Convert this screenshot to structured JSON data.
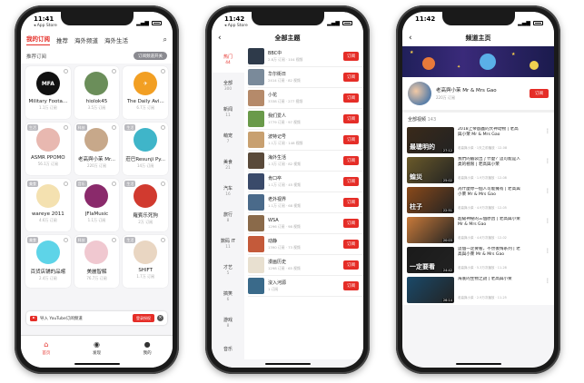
{
  "status": {
    "time1": "11:41",
    "time2": "11:42",
    "back_app": "◂ App Store"
  },
  "phone1": {
    "tabs": [
      "我的订阅",
      "推荐",
      "海外频道",
      "海外生活"
    ],
    "subhead_label": "推荐订阅",
    "subhead_button": "订阅频道开关",
    "cards": [
      {
        "name": "Military Foota...",
        "sub": "1.1万 订阅",
        "tag": "",
        "avatar_bg": "#111111",
        "avatar_text": "MFA"
      },
      {
        "name": "hiolok45",
        "sub": "3.5万 订阅",
        "tag": "",
        "avatar_bg": "#6b8e5a",
        "avatar_text": ""
      },
      {
        "name": "The Daily Avi...",
        "sub": "6.7万 订阅",
        "tag": "",
        "avatar_bg": "#f29f23",
        "avatar_text": "✈"
      },
      {
        "name": "ASMR PPOMO",
        "sub": "56.1万 订阅",
        "tag": "生活",
        "avatar_bg": "#e8b8b0",
        "avatar_text": ""
      },
      {
        "name": "老高與小茉 Mr...",
        "sub": "220万 订阅",
        "tag": "科技",
        "avatar_bg": "#c7a88a",
        "avatar_text": ""
      },
      {
        "name": "莊巴Resunji Py...",
        "sub": "14万 订阅",
        "tag": "生活",
        "avatar_bg": "#3fb5c9",
        "avatar_text": ""
      },
      {
        "name": "wareye 2011",
        "sub": "4.6万 订阅",
        "tag": "美食",
        "avatar_bg": "#f4e1b0",
        "avatar_text": ""
      },
      {
        "name": "JFlaMusic",
        "sub": "1.1万 订阅",
        "tag": "音乐",
        "avatar_bg": "#8a2a6b",
        "avatar_text": ""
      },
      {
        "name": "羅賓乐死狗",
        "sub": "2万 订阅",
        "tag": "生活",
        "avatar_bg": "#d13a2f",
        "avatar_text": ""
      },
      {
        "name": "百货店铺的品嚐",
        "sub": "2.4万 订阅",
        "tag": "美食",
        "avatar_bg": "#5ed4e8",
        "avatar_text": ""
      },
      {
        "name": "美麗智解",
        "sub": "76.7万 订阅",
        "tag": "科技",
        "avatar_bg": "#f0c8d0",
        "avatar_text": ""
      },
      {
        "name": "SHIFT",
        "sub": "1.7万 订阅",
        "tag": "生活",
        "avatar_bg": "#e9d6c2",
        "avatar_text": ""
      }
    ],
    "yt_text": "导入 YouTube订阅频道",
    "yt_button": "登录授权",
    "nav": [
      "首页",
      "发现",
      "我的"
    ]
  },
  "phone2": {
    "title": "全部主题",
    "categories": [
      {
        "name": "热门",
        "count": "44"
      },
      {
        "name": "全部",
        "count": "300"
      },
      {
        "name": "新闻",
        "count": "11"
      },
      {
        "name": "萌宠",
        "count": "7"
      },
      {
        "name": "美食",
        "count": "21"
      },
      {
        "name": "汽车",
        "count": "16"
      },
      {
        "name": "旅行",
        "count": "8"
      },
      {
        "name": "数码 IT",
        "count": "11"
      },
      {
        "name": "才艺",
        "count": "5"
      },
      {
        "name": "搞笑",
        "count": "6"
      },
      {
        "name": "游戏",
        "count": "8"
      },
      {
        "name": "音乐",
        "count": ""
      }
    ],
    "channels": [
      {
        "name": "BBC中",
        "meta": "2.8万 订阅 · 104 视频",
        "color": "#2e3a4a"
      },
      {
        "name": "华尔街日",
        "meta": "2414 订阅 · 82 视频",
        "color": "#7a8a9a"
      },
      {
        "name": "小花",
        "meta": "3338 订阅 · 277 视频",
        "color": "#b58a6a"
      },
      {
        "name": "我们爱人",
        "meta": "1779 订阅 · 97 视频",
        "color": "#6a9a4a"
      },
      {
        "name": "波特记号",
        "meta": "1.1万 订阅 · 148 视频",
        "color": "#c8a070"
      },
      {
        "name": "海外生活",
        "meta": "1.3万 订阅 · 82 视频",
        "color": "#5a4a3a"
      },
      {
        "name": "肯口卒",
        "meta": "1.1万 订阅 · 45 视频",
        "color": "#3a4a6a"
      },
      {
        "name": "老外视界",
        "meta": "1.1万 订阅 · 68 视频",
        "color": "#4a6a8a"
      },
      {
        "name": "WSA",
        "meta": "1296 订阅 · 98 视频",
        "color": "#8a6a4a"
      },
      {
        "name": "动静",
        "meta": "1390 订阅 · 73 视频",
        "color": "#c45a3a"
      },
      {
        "name": "漫画历史",
        "meta": "1298 订阅 · 65 视频",
        "color": "#e8e0d0"
      },
      {
        "name": "沒入河源",
        "meta": "1 订阅",
        "color": "#3a6a8a"
      }
    ],
    "subscribe_label": "订阅"
  },
  "phone3": {
    "title": "频道主页",
    "channel_name": "老高與小茉 Mr & Mrs Gao",
    "channel_sub": "220万 订阅",
    "subscribe_label": "订阅",
    "all_videos_label": "全部视频",
    "all_videos_count": "143",
    "videos": [
      {
        "title": "2018上帝戲蟲的大神动物 | 老高與小茉 Mr & Mrs Gao",
        "meta": "老高與小茉 · 1天之前播放 · 12-08",
        "caption": "最聰明的",
        "color": "#3a2a1a",
        "dur": "27:12"
      },
      {
        "title": "我們的腦袋出了什麼？這可能是人类的極限 | 老高與小茉",
        "meta": "老高與小茉 · 1.9万次播放 · 12-08",
        "caption": "蝗災",
        "color": "#6a5a2a",
        "dur": "25:02"
      },
      {
        "title": "為什麼你一個人可能擁有 | 老高與小茉 Mr & Mrs Gao",
        "meta": "老高與小茉 · 4.9万次播放 · 12-05",
        "caption": "柱子",
        "color": "#8a4a1a",
        "dur": "22:51"
      },
      {
        "title": "超級神秘的三個原因 | 老高與小茉 Mr & Mrs Gao",
        "meta": "老高與小茉 · 4.6万次播放 · 12-02",
        "caption": "",
        "color": "#c87a3a",
        "dur": "20:03"
      },
      {
        "title": "這個一定要看，不然後悔系列 | 老高與小茉 Mr & Mrs Gao",
        "meta": "老高與小茉 · 5.3万次播放 · 11-28",
        "caption": "一定要看",
        "color": "#1a1a1a",
        "dur": "24:42"
      },
      {
        "title": "海底的生物之謎 | 老高與小茉",
        "meta": "老高與小茉 · 2.9万次播放 · 11-25",
        "caption": "",
        "color": "#1a4a6a",
        "dur": "26:14"
      }
    ]
  }
}
